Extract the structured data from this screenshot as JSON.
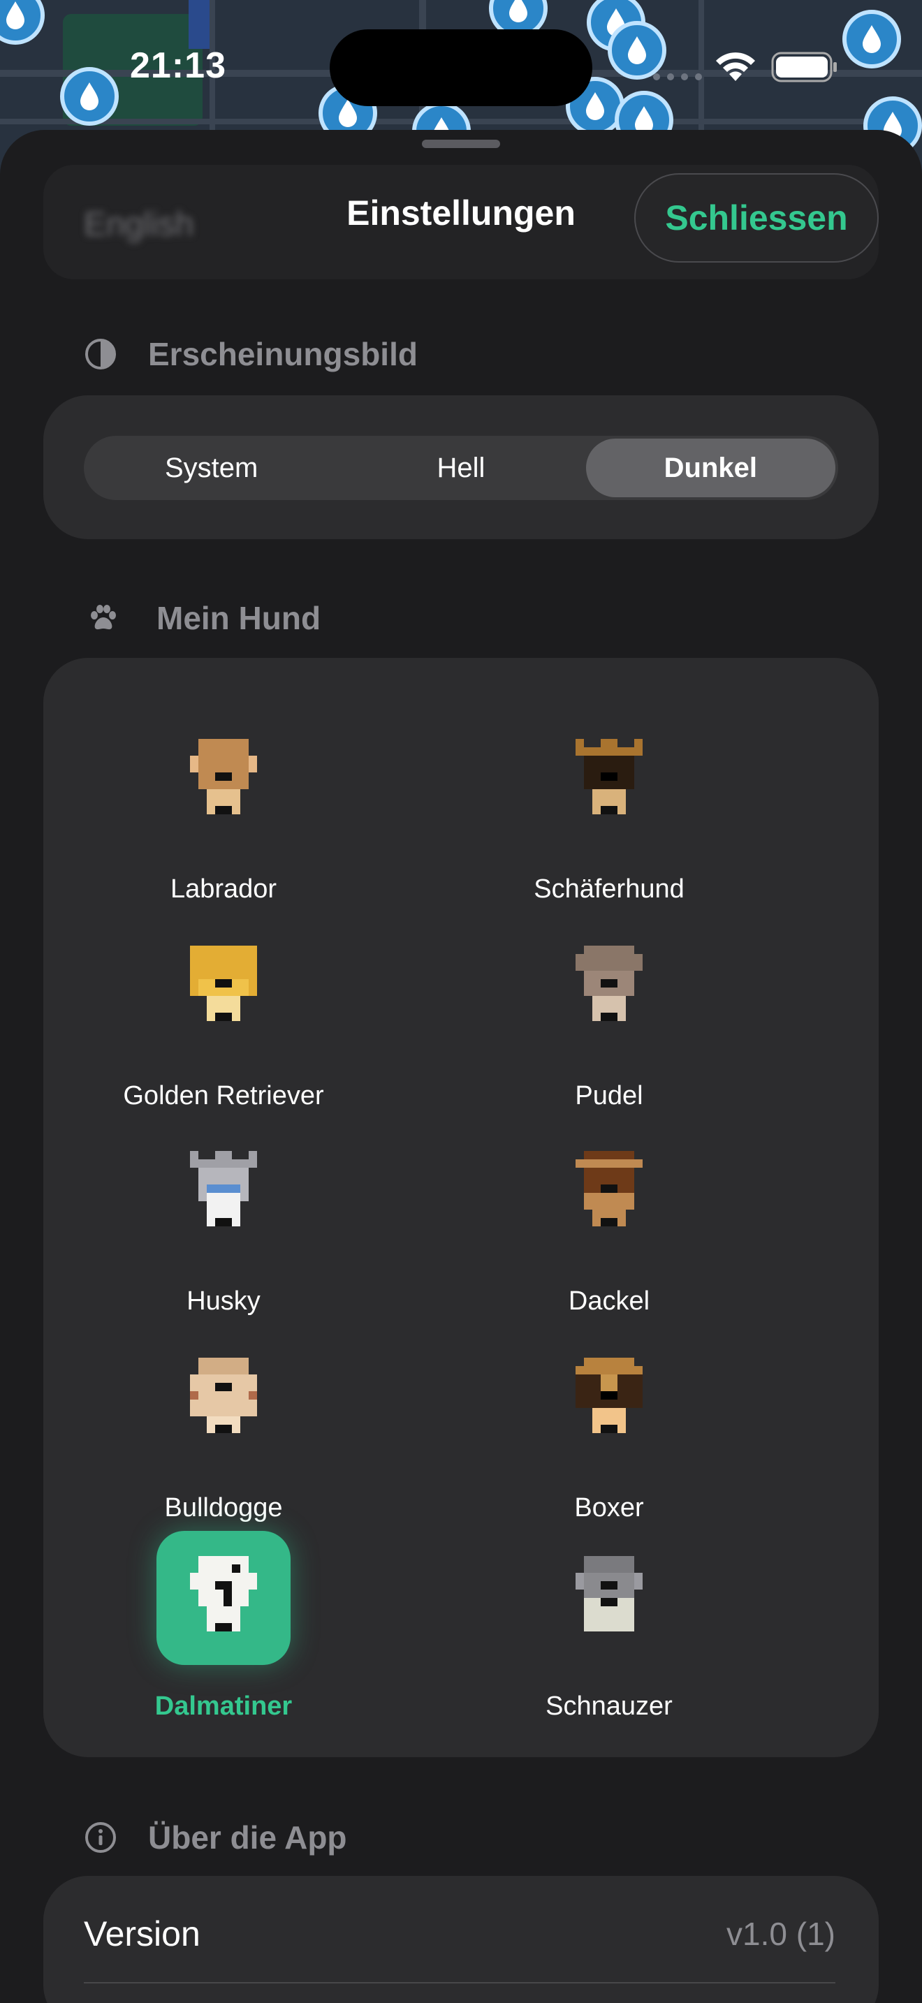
{
  "status_bar": {
    "time": "21:13"
  },
  "header": {
    "language_label": "English",
    "title": "Einstellungen",
    "close_label": "Schliessen"
  },
  "appearance": {
    "section_label": "Erscheinungsbild",
    "options": [
      "System",
      "Hell",
      "Dunkel"
    ],
    "selected": "Dunkel"
  },
  "dog": {
    "section_label": "Mein Hund",
    "selected": "Dalmatiner",
    "breeds": [
      {
        "name": "Labrador",
        "icon": "labrador-icon"
      },
      {
        "name": "Schäferhund",
        "icon": "schaeferhund-icon"
      },
      {
        "name": "Golden Retriever",
        "icon": "golden-retriever-icon"
      },
      {
        "name": "Pudel",
        "icon": "pudel-icon"
      },
      {
        "name": "Husky",
        "icon": "husky-icon"
      },
      {
        "name": "Dackel",
        "icon": "dackel-icon"
      },
      {
        "name": "Bulldogge",
        "icon": "bulldogge-icon"
      },
      {
        "name": "Boxer",
        "icon": "boxer-icon"
      },
      {
        "name": "Dalmatiner",
        "icon": "dalmatiner-icon"
      },
      {
        "name": "Schnauzer",
        "icon": "schnauzer-icon"
      }
    ]
  },
  "about": {
    "section_label": "Über die App",
    "version_label": "Version",
    "version_value": "v1.0 (1)"
  },
  "colors": {
    "accent": "#34c88f",
    "background": "#1c1c1e",
    "card": "#2c2c2e"
  }
}
